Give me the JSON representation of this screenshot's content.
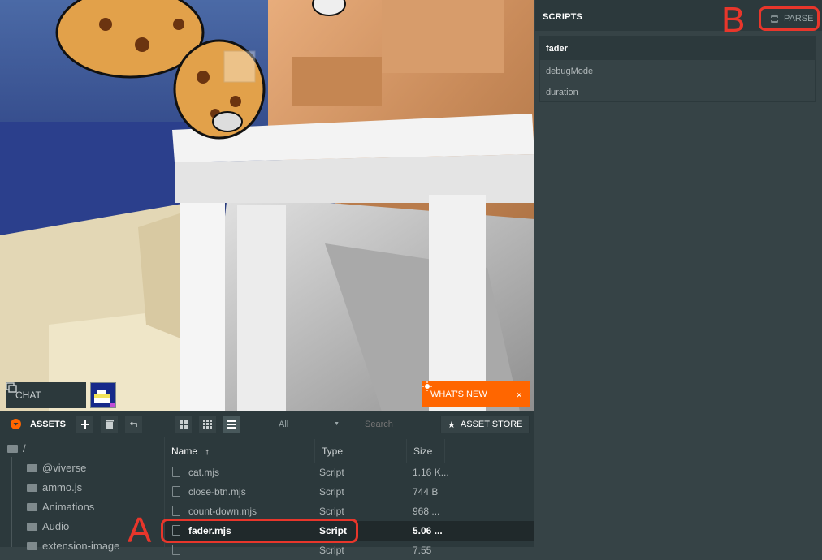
{
  "viewport": {
    "chat_label": "CHAT",
    "whats_new_label": "WHAT'S NEW",
    "whats_new_close": "×"
  },
  "scripts_panel": {
    "title": "SCRIPTS",
    "parse_label": "PARSE",
    "script_name": "fader",
    "attributes": [
      "debugMode",
      "duration"
    ]
  },
  "assets": {
    "title": "ASSETS",
    "filter_value": "All",
    "search_placeholder": "Search",
    "asset_store_label": "ASSET STORE",
    "tree": [
      {
        "label": "/"
      },
      {
        "label": "@viverse"
      },
      {
        "label": "ammo.js"
      },
      {
        "label": "Animations"
      },
      {
        "label": "Audio"
      },
      {
        "label": "extension-image"
      }
    ],
    "columns": {
      "name": "Name",
      "type": "Type",
      "size": "Size"
    },
    "files": [
      {
        "name": "cat.mjs",
        "type": "Script",
        "size": "1.16 K..."
      },
      {
        "name": "close-btn.mjs",
        "type": "Script",
        "size": "744 B"
      },
      {
        "name": "count-down.mjs",
        "type": "Script",
        "size": "968 ..."
      },
      {
        "name": "fader.mjs",
        "type": "Script",
        "size": "5.06 ..."
      },
      {
        "name": "",
        "type": "Script",
        "size": "7.55"
      }
    ]
  },
  "annotations": {
    "a": "A",
    "b": "B"
  },
  "colors": {
    "accent": "#ff6600",
    "annotation": "#e8362b",
    "panel_dark": "#2c393c",
    "panel": "#364346"
  }
}
